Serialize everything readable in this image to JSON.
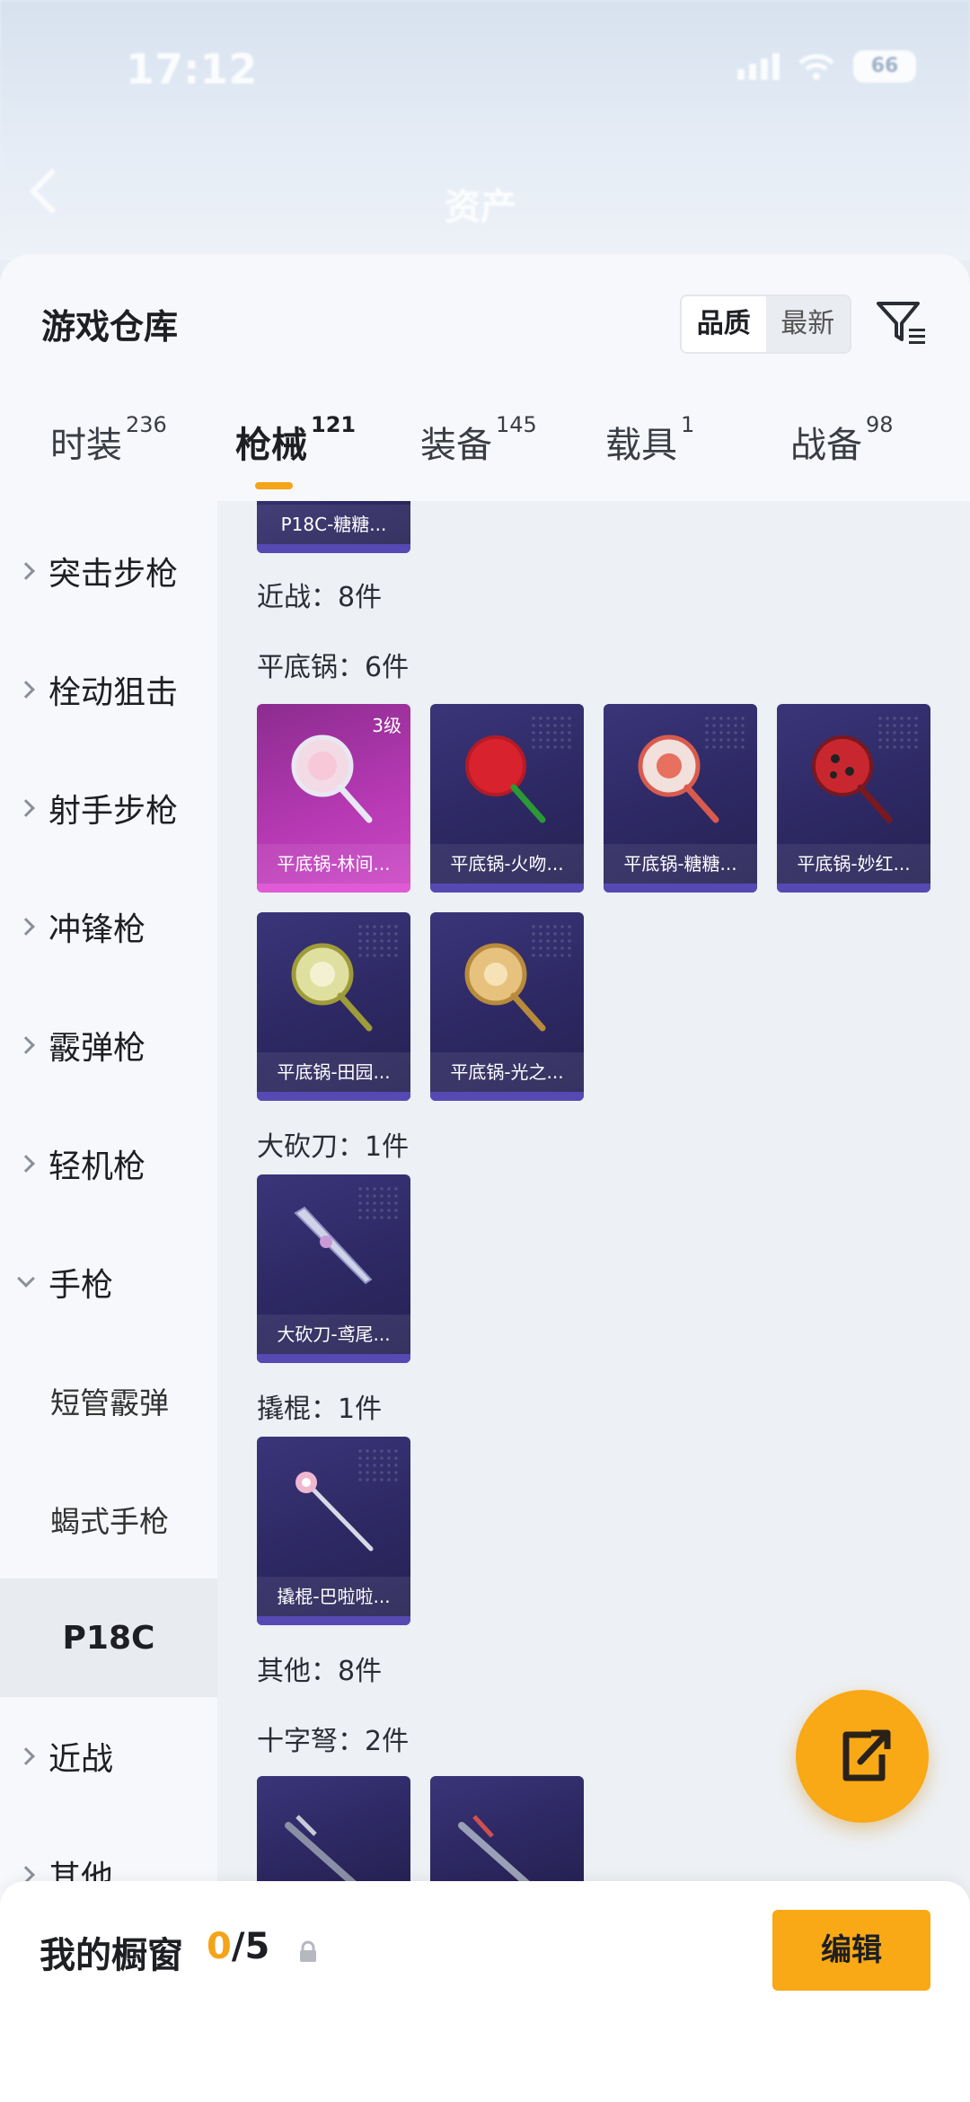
{
  "status_bar": {
    "time": "17:12",
    "battery": "66"
  },
  "background_header": {
    "title": "资产"
  },
  "sheet": {
    "title": "游戏仓库",
    "sort": {
      "quality": "品质",
      "newest": "最新"
    }
  },
  "tabs": [
    {
      "label": "时装",
      "count": "236"
    },
    {
      "label": "枪械",
      "count": "121",
      "active": true
    },
    {
      "label": "装备",
      "count": "145"
    },
    {
      "label": "载具",
      "count": "1"
    },
    {
      "label": "战备",
      "count": "98"
    }
  ],
  "sidebar": {
    "items": [
      {
        "label": "突击步枪"
      },
      {
        "label": "栓动狙击"
      },
      {
        "label": "射手步枪"
      },
      {
        "label": "冲锋枪"
      },
      {
        "label": "霰弹枪"
      },
      {
        "label": "轻机枪"
      },
      {
        "label": "手枪",
        "expanded": true
      },
      {
        "label": "短管霰弹",
        "sub": true
      },
      {
        "label": "蝎式手枪",
        "sub": true
      },
      {
        "label": "P18C",
        "selected": true
      },
      {
        "label": "近战"
      },
      {
        "label": "其他"
      }
    ]
  },
  "content": {
    "top_card": {
      "name": "P18C-糖糖..."
    },
    "melee_label": "近战：8件",
    "pan_label": "平底锅：6件",
    "pans": [
      {
        "name": "平底锅-林间...",
        "level": "3级",
        "rarity": "pink"
      },
      {
        "name": "平底锅-火吻..."
      },
      {
        "name": "平底锅-糖糖..."
      },
      {
        "name": "平底锅-妙红..."
      },
      {
        "name": "平底锅-田园..."
      },
      {
        "name": "平底锅-光之..."
      }
    ],
    "machete_label": "大砍刀：1件",
    "machete": {
      "name": "大砍刀-鸢尾..."
    },
    "crowbar_label": "撬棍：1件",
    "crowbar": {
      "name": "撬棍-巴啦啦..."
    },
    "other_label": "其他：8件",
    "crossbow_label": "十字弩：2件"
  },
  "bottom_bar": {
    "label": "我的橱窗",
    "count_current": "0",
    "count_total": "/5",
    "edit_label": "编辑"
  },
  "colors": {
    "accent": "#f5a318",
    "card": "#2d2862",
    "card_pink": "#b83ab5"
  }
}
